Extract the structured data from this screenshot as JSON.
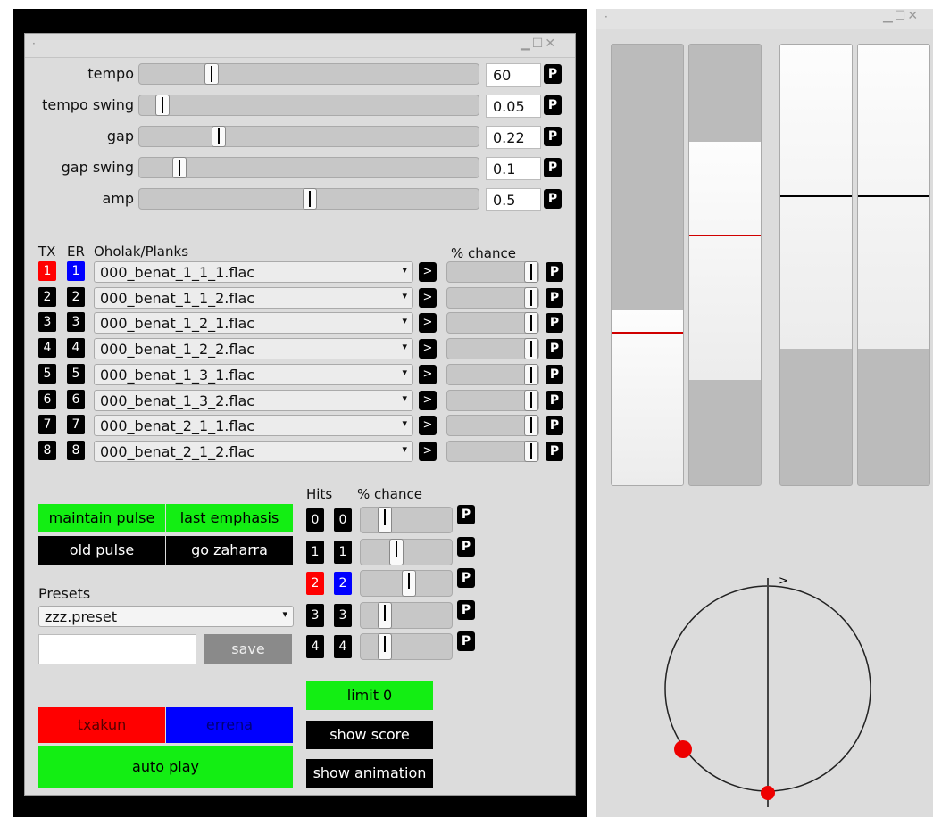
{
  "left_window": {
    "controls": [
      {
        "label": "tempo",
        "value": "60",
        "position": 0.2
      },
      {
        "label": "tempo swing",
        "value": "0.05",
        "position": 0.05
      },
      {
        "label": "gap",
        "value": "0.22",
        "position": 0.22
      },
      {
        "label": "gap swing",
        "value": "0.1",
        "position": 0.1
      },
      {
        "label": "amp",
        "value": "0.5",
        "position": 0.5
      }
    ],
    "p_label": "P",
    "headers": {
      "tx": "TX",
      "er": "ER",
      "planks": "Oholak/Planks",
      "chance": "% chance"
    },
    "planks": [
      {
        "tx": "1",
        "er": "1",
        "file": "000_benat_1_1_1.flac",
        "active": true
      },
      {
        "tx": "2",
        "er": "2",
        "file": "000_benat_1_1_2.flac",
        "active": false
      },
      {
        "tx": "3",
        "er": "3",
        "file": "000_benat_1_2_1.flac",
        "active": false
      },
      {
        "tx": "4",
        "er": "4",
        "file": "000_benat_1_2_2.flac",
        "active": false
      },
      {
        "tx": "5",
        "er": "5",
        "file": "000_benat_1_3_1.flac",
        "active": false
      },
      {
        "tx": "6",
        "er": "6",
        "file": "000_benat_1_3_2.flac",
        "active": false
      },
      {
        "tx": "7",
        "er": "7",
        "file": "000_benat_2_1_1.flac",
        "active": false
      },
      {
        "tx": "8",
        "er": "8",
        "file": "000_benat_2_1_2.flac",
        "active": false
      }
    ],
    "play_label": ">",
    "dropdown_icon": "▾",
    "buttons": {
      "maintain_pulse": "maintain pulse",
      "last_emphasis": "last emphasis",
      "old_pulse": "old pulse",
      "go_zaharra": "go zaharra"
    },
    "presets": {
      "label": "Presets",
      "selected": "zzz.preset",
      "input_value": "",
      "save": "save"
    },
    "hits_headers": {
      "hits": "Hits",
      "chance": "% chance"
    },
    "hits": [
      {
        "tx": "0",
        "er": "0",
        "position": 0.15,
        "active": false
      },
      {
        "tx": "1",
        "er": "1",
        "position": 0.3,
        "active": false
      },
      {
        "tx": "2",
        "er": "2",
        "position": 0.45,
        "active": true
      },
      {
        "tx": "3",
        "er": "3",
        "position": 0.15,
        "active": false
      },
      {
        "tx": "4",
        "er": "4",
        "position": 0.15,
        "active": false
      }
    ],
    "limit": "limit 0",
    "show_score": "show score",
    "show_animation": "show animation",
    "txakun": "txakun",
    "errena": "errena",
    "auto_play": "auto play"
  },
  "right_window": {
    "meters": [
      {
        "fill_from": 0.6,
        "marker": 0.35,
        "marker_color": "#d00000"
      },
      {
        "fill_from": 0.22,
        "marker": 0.57,
        "marker_color": "#d00000"
      },
      {
        "fill_from": 0.31,
        "marker": 0.66,
        "marker_color": "#000000"
      },
      {
        "fill_from": 0.31,
        "marker": 0.66,
        "marker_color": "#000000"
      }
    ],
    "circle_arrow": ">"
  },
  "colors": {
    "green": "#13ee13",
    "red": "#ff0000",
    "blue": "#0000ff"
  }
}
